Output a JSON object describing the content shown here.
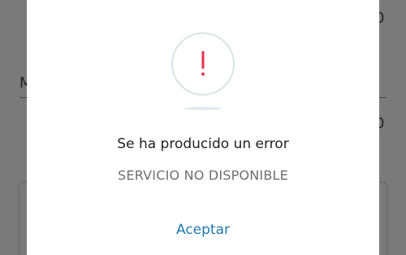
{
  "dialog": {
    "icon": "exclamation-icon",
    "title": "Se ha producido un error",
    "message": "SERVICIO NO DISPONIBLE",
    "accept_label": "Aceptar"
  },
  "background": {
    "field_1_value_partial": "0",
    "field_2_label_partial": "M",
    "field_2_value_partial": "0"
  },
  "colors": {
    "accent": "#1f79ad",
    "error_icon": "#e5334b",
    "icon_ring": "#d7e3e8"
  }
}
